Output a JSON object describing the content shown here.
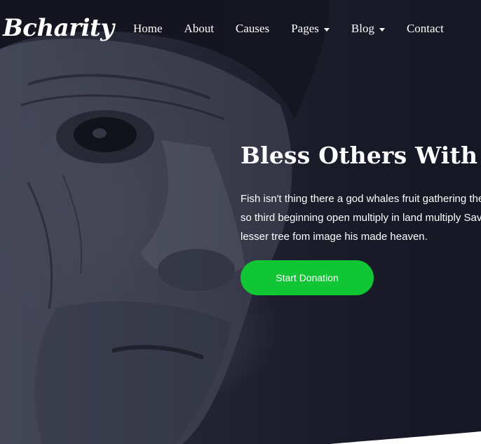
{
  "brand": {
    "logo_text": "Bcharity"
  },
  "nav": {
    "items": [
      {
        "label": "Home",
        "has_dropdown": false
      },
      {
        "label": "About",
        "has_dropdown": false
      },
      {
        "label": "Causes",
        "has_dropdown": false
      },
      {
        "label": "Pages",
        "has_dropdown": true
      },
      {
        "label": "Blog",
        "has_dropdown": true
      },
      {
        "label": "Contact",
        "has_dropdown": false
      }
    ]
  },
  "hero": {
    "headline": "Bless Others With You",
    "description_lines": [
      "Fish isn't thing there a god whales fruit gathering the",
      "so third beginning open multiply in land multiply Sav",
      "lesser tree fom image his made heaven."
    ],
    "cta_label": "Start Donation"
  },
  "colors": {
    "accent": "#10c634",
    "text": "#ffffff",
    "overlay": "#1a1c2a"
  }
}
